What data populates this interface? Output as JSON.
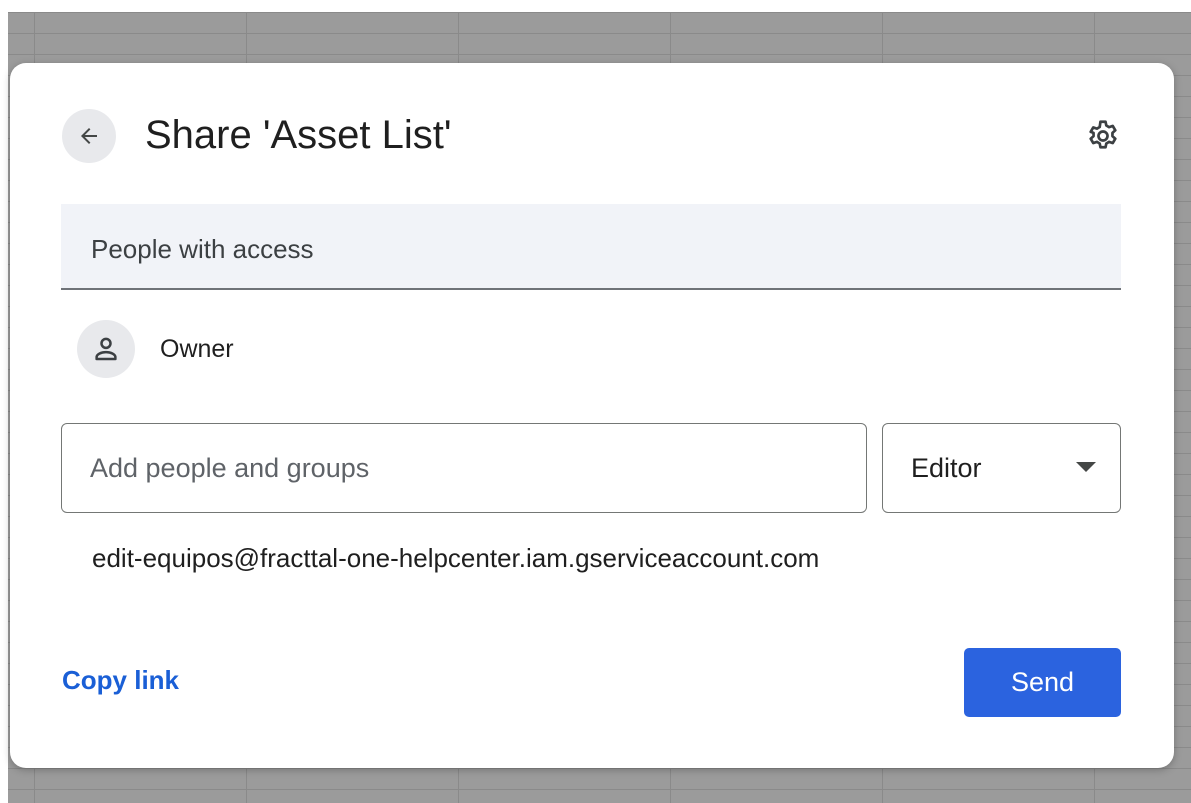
{
  "dialog": {
    "title": "Share 'Asset List'",
    "back_icon": "arrow-left-icon",
    "settings_icon": "gear-icon"
  },
  "access": {
    "header_label": "People with access",
    "owner": {
      "avatar_icon": "person-icon",
      "label": "Owner"
    }
  },
  "add_people": {
    "placeholder": "Add people and groups",
    "value": ""
  },
  "role_select": {
    "selected": "Editor",
    "arrow_icon": "caret-down-icon"
  },
  "suggested_email": "edit-equipos@fracttal-one-helpcenter.iam.gserviceaccount.com",
  "footer": {
    "copy_link_label": "Copy link",
    "send_label": "Send"
  },
  "colors": {
    "accent": "#2b63df",
    "link": "#1a5fd6",
    "header_bg": "#f1f3f8"
  }
}
